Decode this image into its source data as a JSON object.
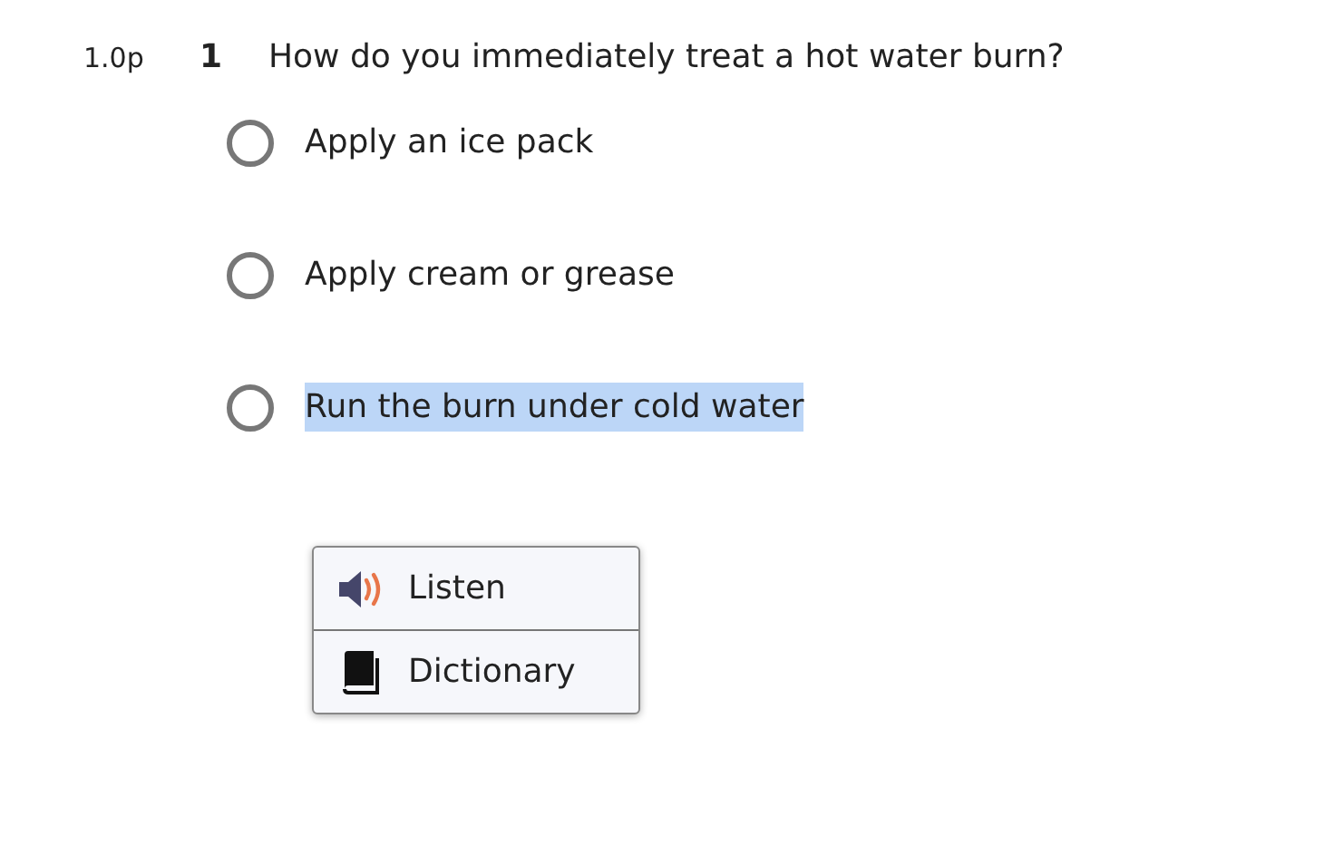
{
  "question": {
    "points": "1.0p",
    "number": "1",
    "text": "How do you immediately treat a hot water burn?"
  },
  "options": [
    {
      "label": "Apply an ice pack",
      "selected": false,
      "highlighted": false
    },
    {
      "label": "Apply cream or grease",
      "selected": false,
      "highlighted": false
    },
    {
      "label": "Run the burn under cold water",
      "selected": false,
      "highlighted": true
    }
  ],
  "context_menu": [
    {
      "kind": "listen",
      "label": "Listen"
    },
    {
      "kind": "dictionary",
      "label": "Dictionary"
    }
  ]
}
